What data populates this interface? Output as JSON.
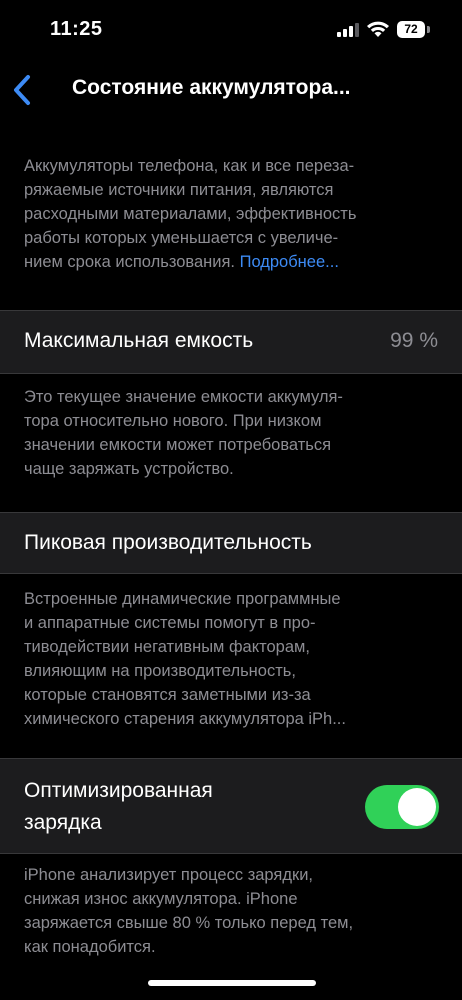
{
  "status_bar": {
    "time": "11:25",
    "battery_level": "72",
    "signal_icon": "cellular-signal-icon",
    "wifi_icon": "wifi-icon"
  },
  "nav": {
    "back_icon": "chevron-left-icon",
    "title": "Состояние аккумулятора..."
  },
  "intro": {
    "text": "Аккумуляторы телефона, как и все переза-\nряжаемые источники питания, являются\nрасходными материалами, эффективность\nработы которых уменьшается с увеличе-\nнием срока использования. ",
    "link": "Подробнее..."
  },
  "max_capacity": {
    "label": "Максимальная емкость",
    "value": "99 %",
    "description": "Это текущее значение емкости аккумуля-\nтора относительно нового. При низком\nзначении емкости может потребоваться\nчаще заряжать устройство."
  },
  "peak_performance": {
    "label": "Пиковая производительность",
    "description": "Встроенные динамические программные\nи аппаратные системы помогут в про-\nтиводействии негативным факторам,\nвлияющим на производительность,\nкоторые становятся заметными из-за\nхимического старения аккумулятора iPh..."
  },
  "optimized_charging": {
    "label": "Оптимизированная\nзарядка",
    "enabled": true,
    "toggle_color": "#30d158",
    "description": "iPhone анализирует процесс зарядки,\nснижая износ аккумулятора. iPhone\nзаряжается свыше 80 % только перед тем,\nкак понадобится."
  },
  "colors": {
    "background": "#000000",
    "cell": "#1c1c1e",
    "secondary_text": "#8d8d93",
    "link": "#3d8bf5"
  }
}
